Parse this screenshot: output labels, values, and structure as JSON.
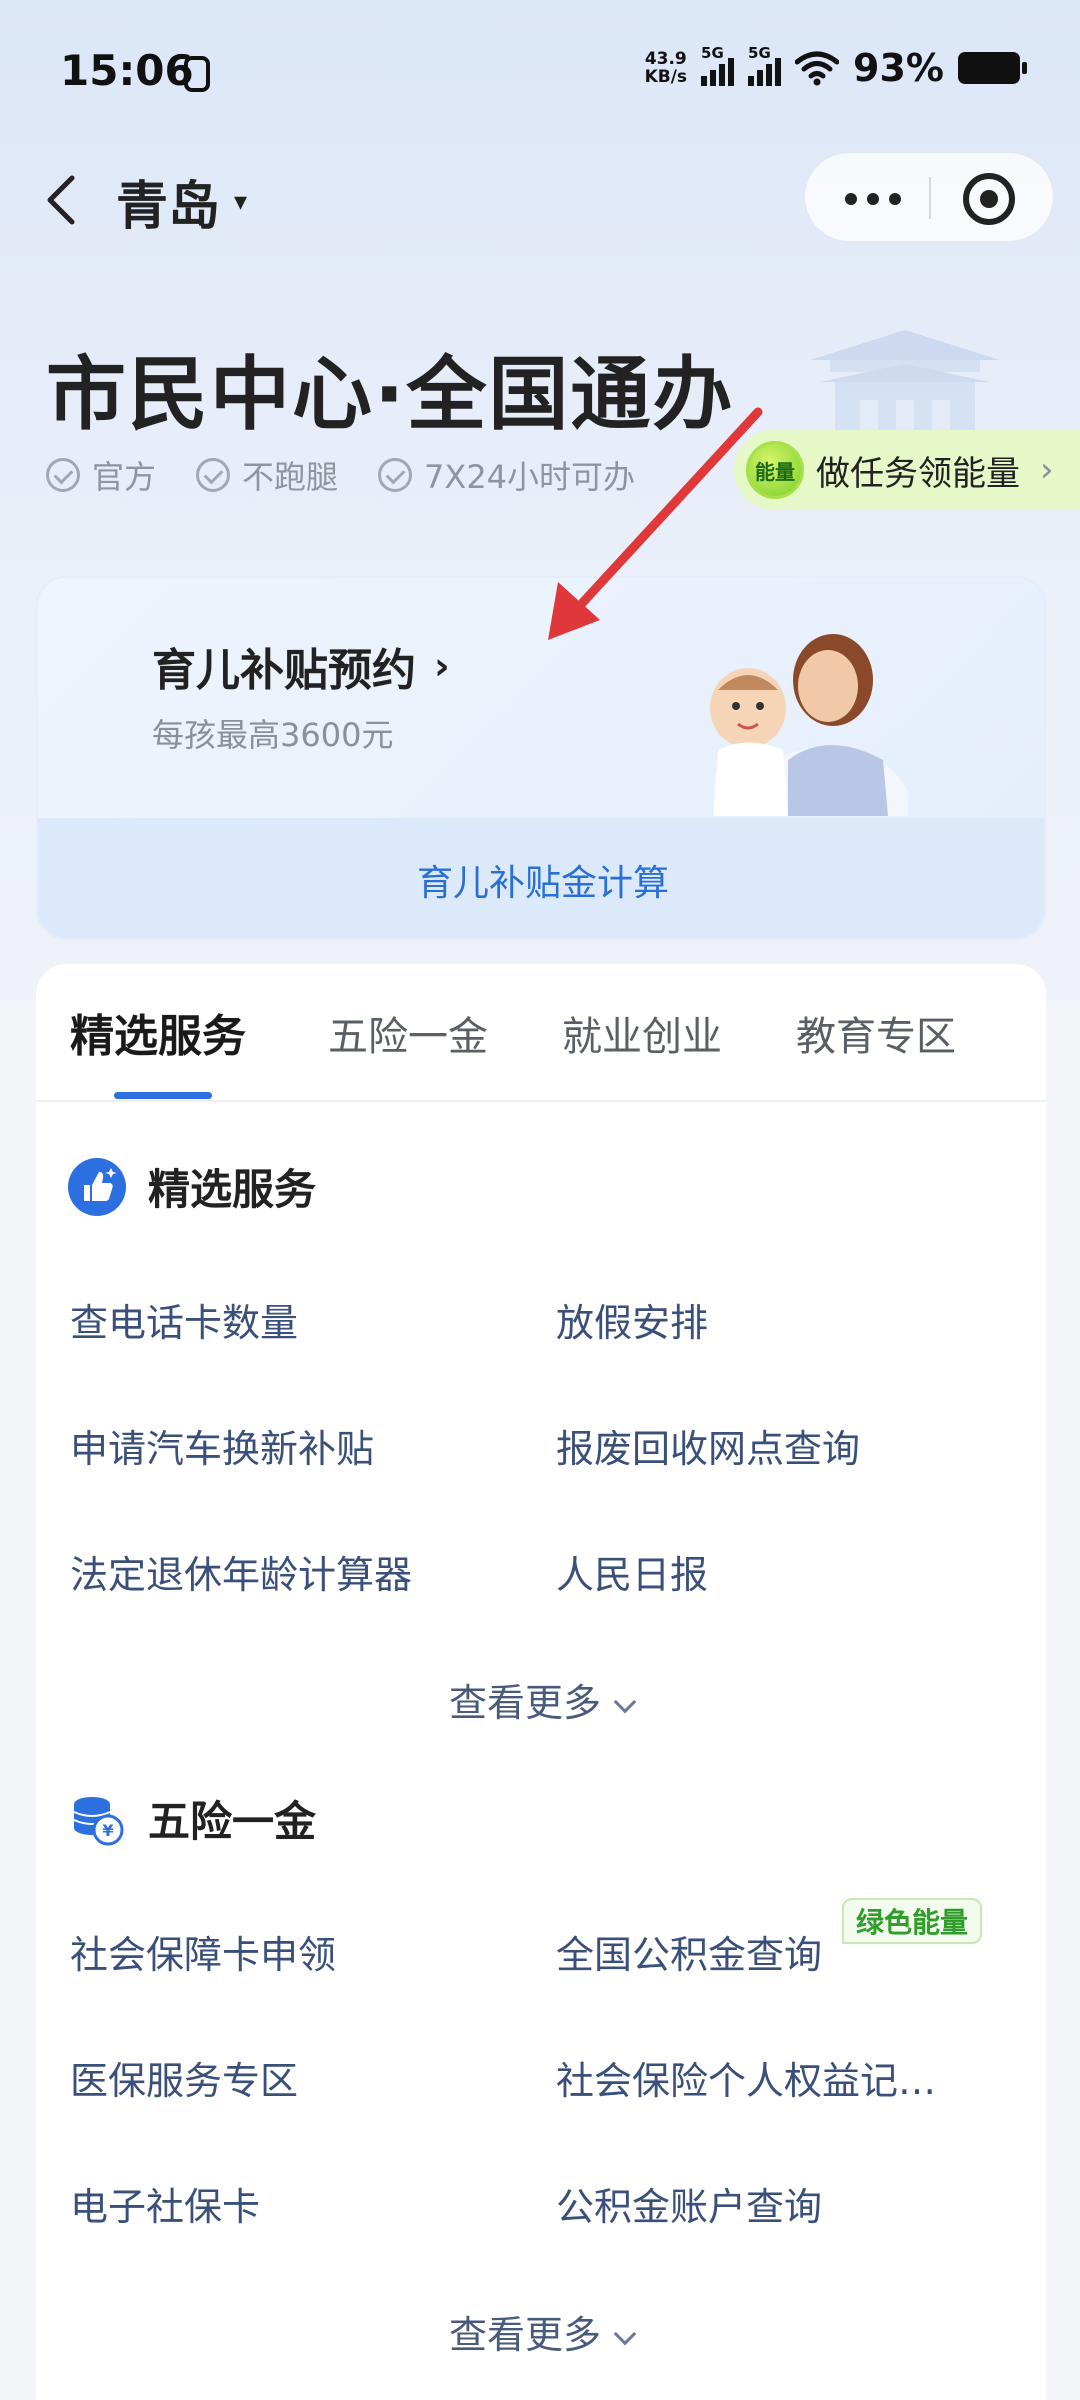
{
  "status_bar": {
    "time": "15:06",
    "net_speed": "43.9",
    "net_unit": "KB/s",
    "sim1": "5G",
    "sim2": "5G",
    "battery": "93%"
  },
  "nav": {
    "city": "青岛",
    "city_caret": "▾"
  },
  "header": {
    "title": "市民中心·全国通办",
    "tags": [
      "官方",
      "不跑腿",
      "7X24小时可办"
    ],
    "energy_badge": "能量",
    "energy_task": "做任务领能量",
    "energy_chevron": "›"
  },
  "subsidy_card": {
    "title": "育儿补贴预约",
    "chevron": "›",
    "subtitle": "每孩最高3600元",
    "footer": "育儿补贴金计算"
  },
  "tabs": [
    "精选服务",
    "五险一金",
    "就业创业",
    "教育专区"
  ],
  "sections": {
    "featured": {
      "title": "精选服务",
      "items": [
        "查电话卡数量",
        "放假安排",
        "申请汽车换新补贴",
        "报废回收网点查询",
        "法定退休年龄计算器",
        "人民日报"
      ],
      "more": "查看更多"
    },
    "insurance": {
      "title": "五险一金",
      "items": [
        "社会保障卡申领",
        "全国公积金查询",
        "医保服务专区",
        "社会保险个人权益记…",
        "电子社保卡",
        "公积金账户查询"
      ],
      "badge": "绿色能量",
      "more": "查看更多"
    }
  },
  "colors": {
    "accent_blue": "#2b6fe0",
    "link_blue": "#2a6fd6",
    "energy_green": "#2f9e2a",
    "annotation_red": "#e0383a"
  }
}
